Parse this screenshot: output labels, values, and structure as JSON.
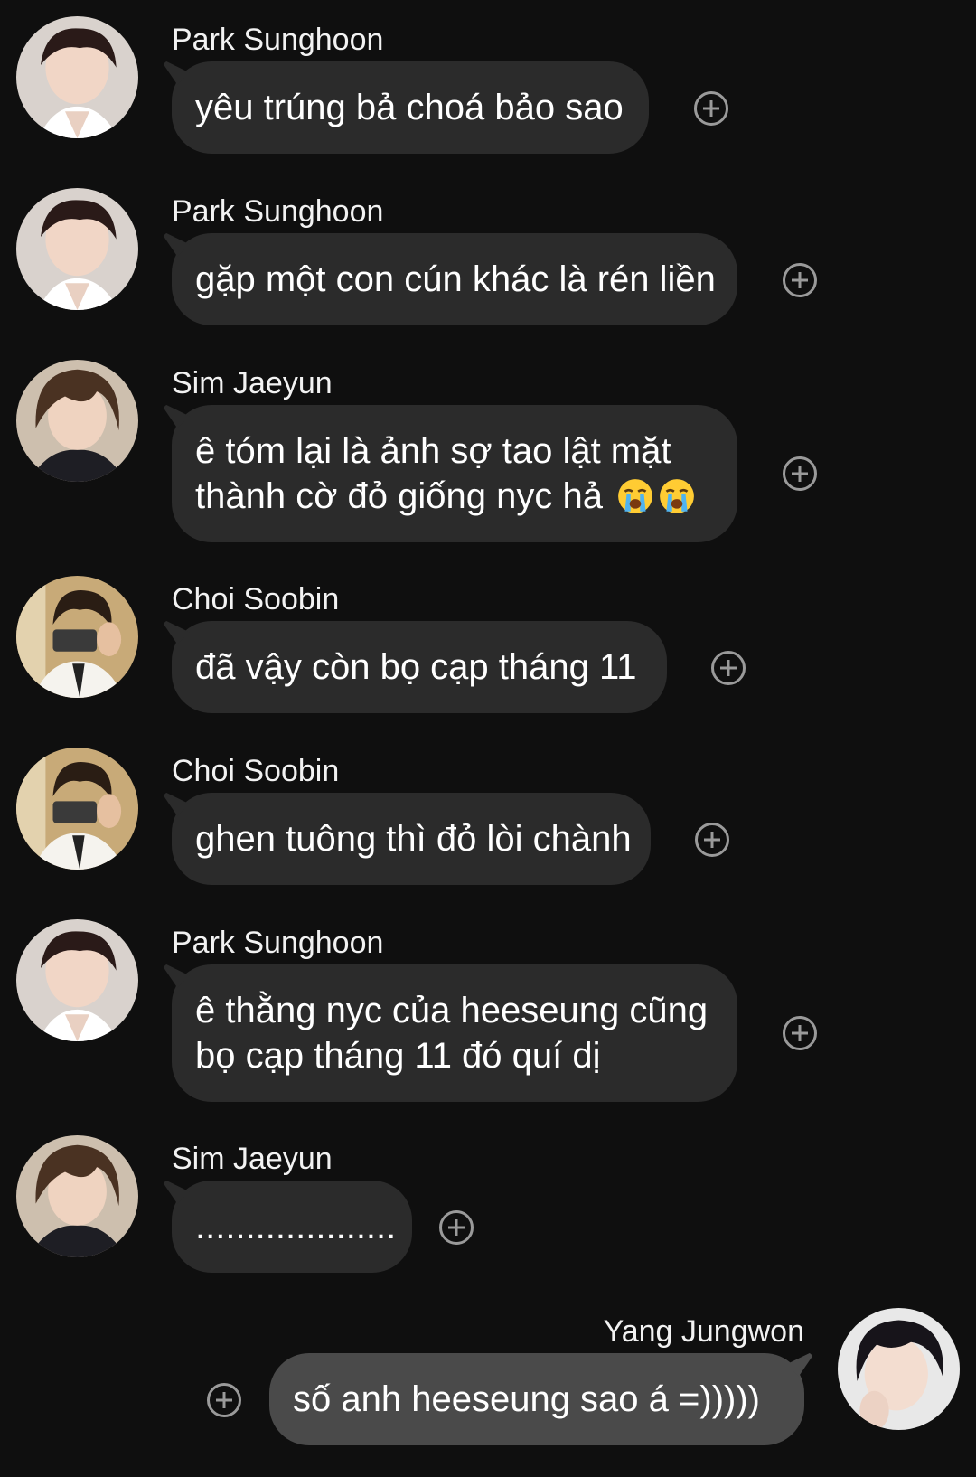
{
  "messages": [
    {
      "sender": "Park Sunghoon",
      "avatar": "avatar-park-sunghoon",
      "lines": [
        "yêu trúng bả choá bảo sao"
      ],
      "direction": "in"
    },
    {
      "sender": "Park Sunghoon",
      "avatar": "avatar-park-sunghoon",
      "lines": [
        "gặp một con cún khác là rén liền"
      ],
      "direction": "in"
    },
    {
      "sender": "Sim Jaeyun",
      "avatar": "avatar-sim-jaeyun",
      "lines": [
        "ê tóm lại là ảnh sợ tao lật mặt",
        "thành cờ đỏ giống nyc hả"
      ],
      "emoji": [
        "loudly-crying-face",
        "loudly-crying-face"
      ],
      "direction": "in"
    },
    {
      "sender": "Choi Soobin",
      "avatar": "avatar-choi-soobin",
      "lines": [
        "đã vậy còn bọ cạp tháng 11"
      ],
      "direction": "in"
    },
    {
      "sender": "Choi Soobin",
      "avatar": "avatar-choi-soobin",
      "lines": [
        "ghen tuông thì đỏ lòi chành"
      ],
      "direction": "in"
    },
    {
      "sender": "Park Sunghoon",
      "avatar": "avatar-park-sunghoon",
      "lines": [
        "ê thằng nyc của heeseung cũng",
        "bọ cạp tháng 11 đó quí dị"
      ],
      "direction": "in"
    },
    {
      "sender": "Sim Jaeyun",
      "avatar": "avatar-sim-jaeyun",
      "lines": [
        "...................."
      ],
      "direction": "in"
    },
    {
      "sender": "Yang Jungwon",
      "avatar": "avatar-yang-jungwon",
      "lines": [
        "số anh heeseung sao á =)))))"
      ],
      "direction": "out"
    }
  ],
  "icons": {
    "reaction": "add-reaction-icon",
    "emoji": "loudly-crying-face"
  },
  "colors": {
    "background": "#0f0f0f",
    "incoming_bubble": "#2b2b2b",
    "outgoing_bubble": "#4a4a4a",
    "text": "#ffffff",
    "reaction_icon": "#9a9a9a"
  }
}
